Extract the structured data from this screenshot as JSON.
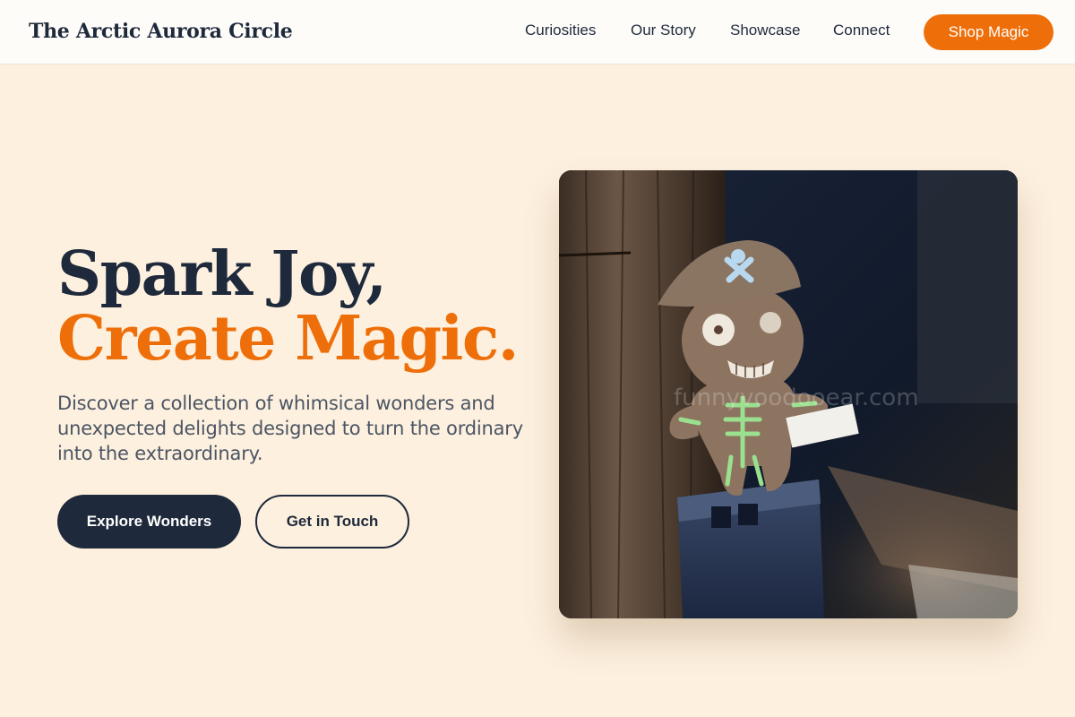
{
  "header": {
    "brand": "The Arctic Aurora Circle",
    "nav": [
      "Curiosities",
      "Our Story",
      "Showcase",
      "Connect"
    ],
    "cta": "Shop Magic"
  },
  "hero": {
    "title_line1": "Spark Joy,",
    "title_line2": "Create Magic.",
    "subtitle": "Discover a collection of whimsical wonders and unexpected delights designed to turn the ordinary into the extraordinary.",
    "primary_button": "Explore Wonders",
    "secondary_button": "Get in Touch",
    "image": {
      "subject": "handmade felt pirate voodoo doll on a wooden post",
      "watermark": "funnyvoodooear.com"
    }
  },
  "colors": {
    "background": "#fdf0df",
    "header_bg": "#fefcf9",
    "navy": "#1e293b",
    "accent": "#ee6f0a"
  }
}
